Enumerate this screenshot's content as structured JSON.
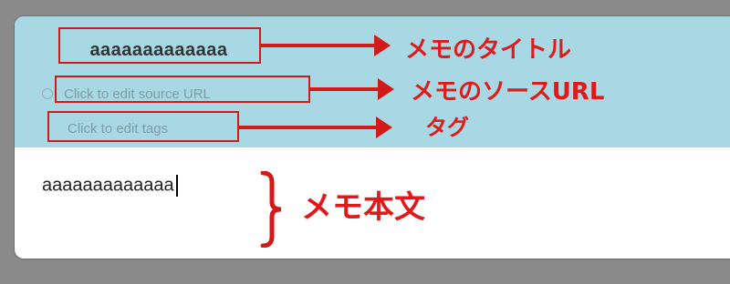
{
  "note": {
    "title": "aaaaaaaaaaaaa",
    "source_url_placeholder": "Click to edit source URL",
    "tags_placeholder": "Click to edit tags",
    "body_text": "aaaaaaaaaaaaa"
  },
  "annotations": {
    "title_label": "メモのタイトル",
    "source_label": "メモのソースURL",
    "tags_label": "タグ",
    "body_label": "メモ本文"
  },
  "colors": {
    "header_band": "#a8d8e4",
    "annotation_red": "#d11a1a"
  },
  "icons": {
    "source": "globe-icon"
  }
}
